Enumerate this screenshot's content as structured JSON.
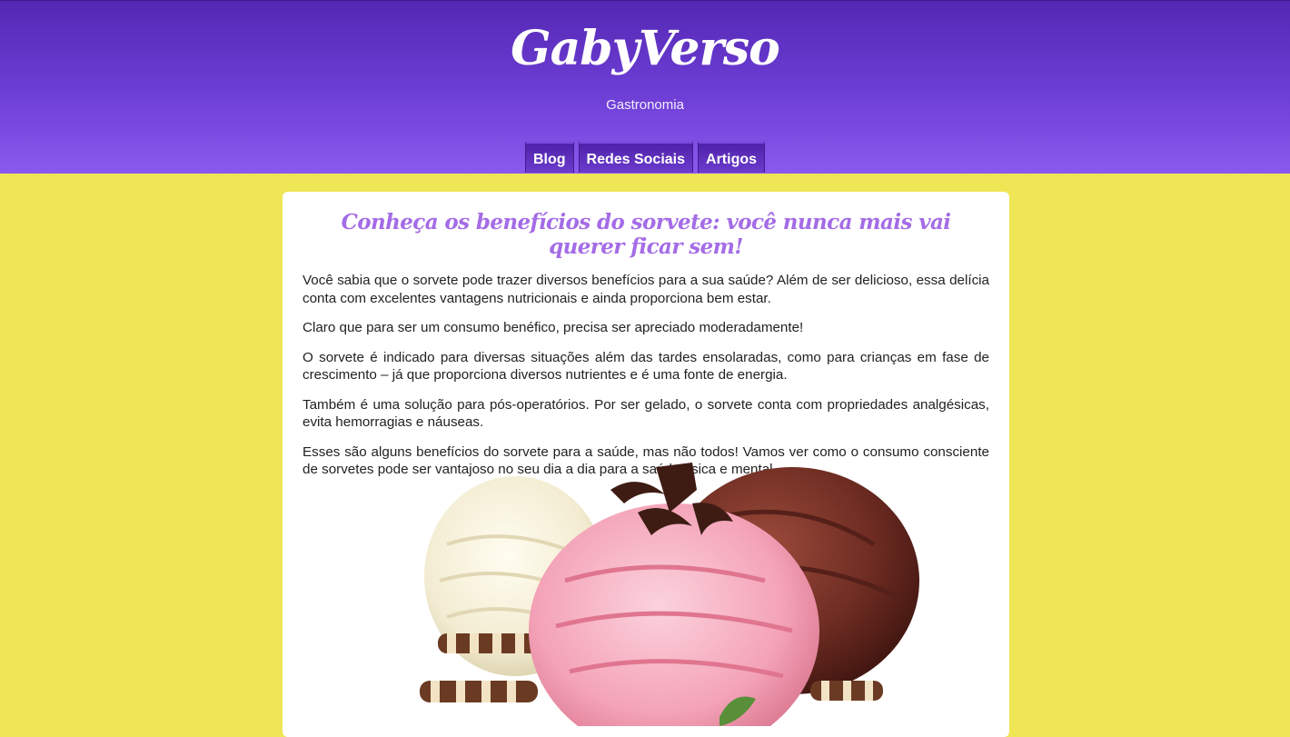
{
  "site": {
    "logo": "GabyVerso",
    "tagline": "Gastronomia"
  },
  "nav": {
    "items": [
      {
        "label": "Blog"
      },
      {
        "label": "Redes Sociais"
      },
      {
        "label": "Artigos"
      }
    ]
  },
  "article": {
    "title": "Conheça os benefícios do sorvete: você nunca mais vai querer ficar sem!",
    "paragraphs": [
      "Você sabia que o sorvete pode trazer diversos benefícios para a sua saúde? Além de ser delicioso, essa delícia conta com excelentes vantagens nutricionais e ainda proporciona bem estar.",
      "Claro que para ser um consumo benéfico, precisa ser apreciado moderadamente!",
      "O sorvete é indicado para diversas situações além das tardes ensolaradas, como para crianças em fase de crescimento – já que proporciona diversos nutrientes e é uma fonte de energia.",
      "Também é uma solução para pós-operatórios. Por ser gelado, o sorvete conta com propriedades analgésicas, evita hemorragias e náuseas.",
      "Esses são alguns benefícios do sorvete para a saúde, mas não todos! Vamos ver como o consumo consciente de sorvetes pode ser vantajoso no seu dia a dia para a saúde física e mental."
    ]
  },
  "colors": {
    "header_top": "#5428b4",
    "header_bottom": "#8b59ee",
    "page_background": "#efe655",
    "title": "#a46ce6"
  }
}
